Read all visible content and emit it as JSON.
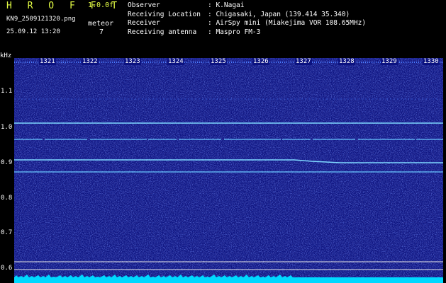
{
  "header": {
    "logo": "H R O F F T",
    "version": "1.0.0f",
    "filename": "KN9_2509121320.png",
    "mode": "meteor",
    "datetime": "25.09.12 13:20",
    "count": "7",
    "info": [
      {
        "key": "Observer",
        "value": ": K.Nagai"
      },
      {
        "key": "Receiving Location",
        "value": ": Chigasaki, Japan (139.414 35.340)"
      },
      {
        "key": "Receiver",
        "value": ": AirSpy mini (Miakejima VOR 108.65MHz)"
      },
      {
        "key": "Receiving antenna",
        "value": ": Maspro FM-3"
      }
    ]
  },
  "axes": {
    "y_unit": "kHz",
    "y_ticks": [
      "1.1",
      "1.0",
      "0.9",
      "0.8",
      "0.7",
      "0.6"
    ],
    "x_ticks": [
      "1321",
      "1322",
      "1323",
      "1324",
      "1325",
      "1326",
      "1327",
      "1328",
      "1329",
      "1330"
    ]
  },
  "colors": {
    "background": "#0b1280",
    "signal": "#7fd8ff",
    "baseline": "#00d8ff",
    "logo": "#e6ff45"
  }
}
